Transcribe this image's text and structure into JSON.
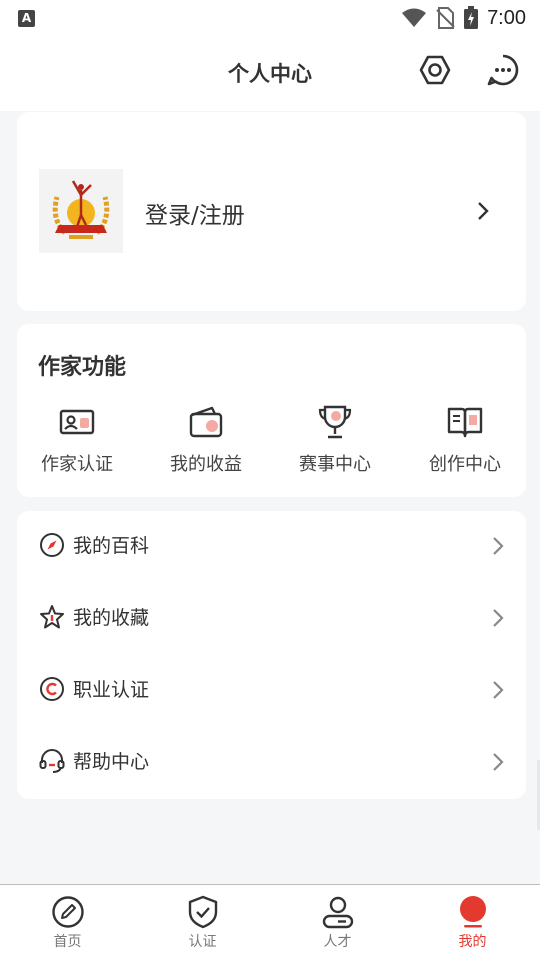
{
  "status_bar": {
    "app_indicator": "A",
    "time": "7:00",
    "icons": [
      "wifi-icon",
      "no-sim-icon",
      "battery-charging-icon"
    ]
  },
  "header": {
    "title": "个人中心",
    "icons": [
      "settings-hex-icon",
      "message-icon"
    ]
  },
  "profile": {
    "login_label": "登录/注册",
    "logo_icon": "award-logo-icon"
  },
  "writer_functions": {
    "title": "作家功能",
    "items": [
      {
        "label": "作家认证",
        "icon": "id-card-icon"
      },
      {
        "label": "我的收益",
        "icon": "wallet-icon"
      },
      {
        "label": "赛事中心",
        "icon": "trophy-icon"
      },
      {
        "label": "创作中心",
        "icon": "book-icon"
      }
    ]
  },
  "menu_list": {
    "items": [
      {
        "label": "我的百科",
        "icon": "compass-icon"
      },
      {
        "label": "我的收藏",
        "icon": "star-icon"
      },
      {
        "label": "职业认证",
        "icon": "copyright-icon"
      },
      {
        "label": "帮助中心",
        "icon": "headset-icon"
      }
    ]
  },
  "tab_bar": {
    "tabs": [
      {
        "label": "首页",
        "icon": "pen-circle-icon",
        "active": false
      },
      {
        "label": "认证",
        "icon": "shield-check-icon",
        "active": false
      },
      {
        "label": "人才",
        "icon": "person-icon",
        "active": false
      },
      {
        "label": "我的",
        "icon": "me-dot-icon",
        "active": true
      }
    ]
  },
  "colors": {
    "accent": "#e3392f",
    "background": "#f5f6f8",
    "card": "#ffffff",
    "text": "#333333",
    "icon_stroke": "#333333",
    "icon_fill_soft": "#f4a9a2"
  }
}
